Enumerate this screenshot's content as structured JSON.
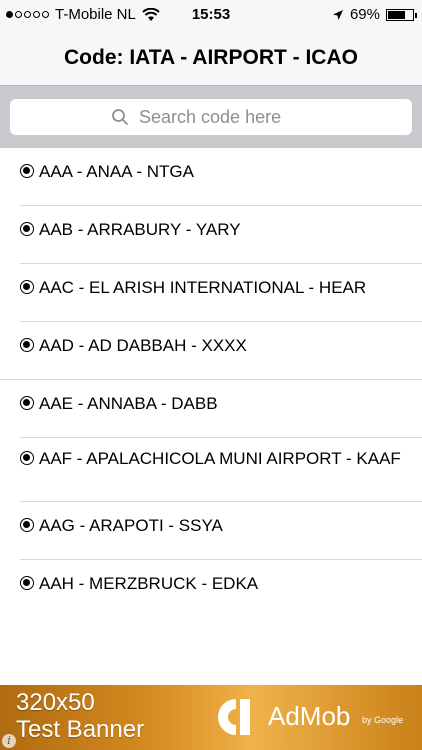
{
  "status_bar": {
    "signal_dots": [
      true,
      false,
      false,
      false,
      false
    ],
    "carrier": "T-Mobile NL",
    "time": "15:53",
    "battery_percent_label": "69%",
    "battery_level": 0.69
  },
  "nav": {
    "title": "Code: IATA - AIRPORT - ICAO"
  },
  "search": {
    "placeholder": "Search code here"
  },
  "list": {
    "items": [
      {
        "label": "AAA - ANAA - NTGA"
      },
      {
        "label": "AAB - ARRABURY - YARY"
      },
      {
        "label": "AAC - EL ARISH INTERNATIONAL - HEAR"
      },
      {
        "label": "AAD - AD DABBAH - XXXX"
      },
      {
        "label": "AAE - ANNABA - DABB"
      },
      {
        "label": "AAF - APALACHICOLA MUNI AIRPORT - KAAF"
      },
      {
        "label": "AAG - ARAPOTI - SSYA"
      },
      {
        "label": "AAH - MERZBRUCK - EDKA"
      }
    ]
  },
  "ad": {
    "line1": "320x50",
    "line2": "Test Banner",
    "brand": "AdMob",
    "by": "by Google",
    "info": "i"
  }
}
